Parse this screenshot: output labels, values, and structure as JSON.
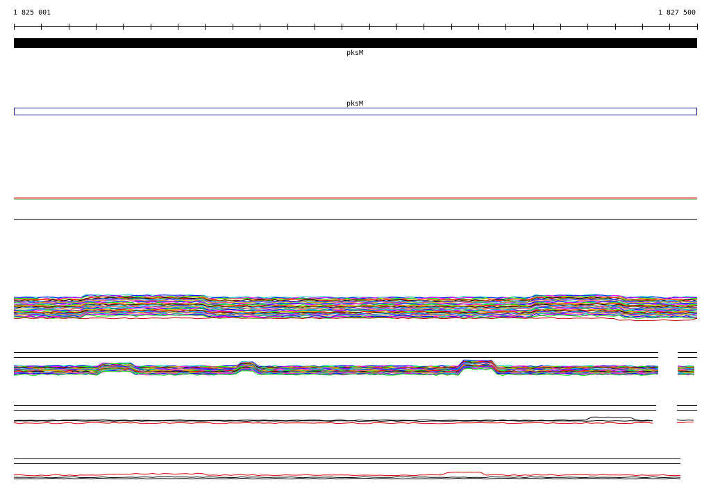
{
  "ruler": {
    "start_label": "1 825 001",
    "end_label": "1 827 500"
  },
  "tracks": {
    "gene": {
      "label": "pksM",
      "color": "#000000"
    },
    "cds": {
      "label": "pksM",
      "color": "#1a1a9a"
    }
  },
  "colors": {
    "palette": [
      "#00c0c0",
      "#0000ff",
      "#ff00ff",
      "#00ff00",
      "#ffa500",
      "#ff0000",
      "#000000",
      "#808000",
      "#00a0ff",
      "#8000ff",
      "#c0c000",
      "#ff6080"
    ],
    "secondary_red": "#e00000",
    "secondary_green": "#40a040"
  }
}
